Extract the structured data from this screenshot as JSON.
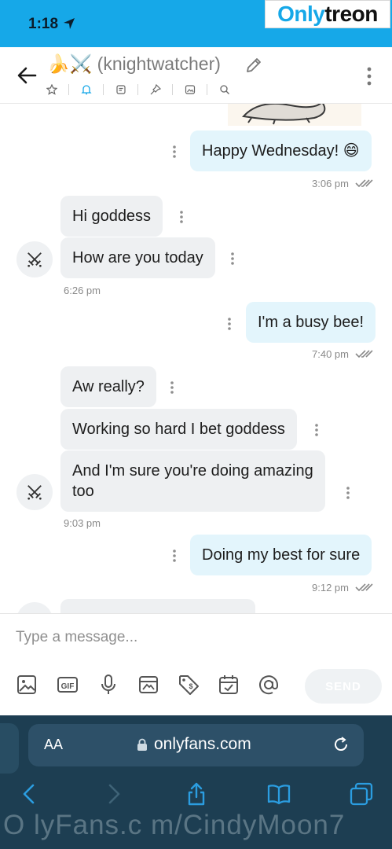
{
  "status_bar": {
    "time": "1:18"
  },
  "watermark": {
    "part1": "Only",
    "part2": "treon"
  },
  "header": {
    "contact_name": "🍌⚔️ (knightwatcher)"
  },
  "messages": [
    {
      "id": "m1",
      "direction": "outgoing",
      "text": "Happy Wednesday! 😄"
    },
    {
      "id": "m1-time",
      "text": "3:06 pm"
    },
    {
      "id": "m2",
      "direction": "incoming",
      "text": "Hi goddess"
    },
    {
      "id": "m3",
      "direction": "incoming",
      "text": "How are you today"
    },
    {
      "id": "m3-time",
      "text": "6:26 pm"
    },
    {
      "id": "m4",
      "direction": "outgoing",
      "text": "I'm a busy bee!"
    },
    {
      "id": "m4-time",
      "text": "7:40 pm"
    },
    {
      "id": "m5",
      "direction": "incoming",
      "text": "Aw really?"
    },
    {
      "id": "m6",
      "direction": "incoming",
      "text": "Working so hard I bet goddess"
    },
    {
      "id": "m7",
      "direction": "incoming",
      "line1": "And I'm sure you're doing amazing",
      "line2": "too"
    },
    {
      "id": "m7-time",
      "text": "9:03 pm"
    },
    {
      "id": "m8",
      "direction": "outgoing",
      "text": "Doing my best for sure"
    },
    {
      "id": "m8-time",
      "text": "9:12 pm"
    }
  ],
  "composer": {
    "placeholder": "Type a message...",
    "send_label": "SEND"
  },
  "browser": {
    "aa_label": "AA",
    "url": "onlyfans.com"
  },
  "bottom_watermark": "O lyFans.c m/CindyMoon7",
  "colors": {
    "accent": "#16a8e8",
    "outgoing_bubble": "#e3f5fc",
    "incoming_bubble": "#eef0f2",
    "browser_bar": "#1d3e52"
  },
  "icons": [
    "location-arrow-icon",
    "back-arrow-icon",
    "pencil-icon",
    "star-icon",
    "bell-icon",
    "note-icon",
    "pin-icon",
    "image-icon",
    "search-icon",
    "more-vertical-icon",
    "crossed-swords-icon",
    "double-check-icon",
    "gallery-icon",
    "gif-icon",
    "microphone-icon",
    "vault-icon",
    "price-tag-icon",
    "calendar-check-icon",
    "at-icon",
    "lock-icon",
    "reload-icon",
    "nav-back-icon",
    "nav-forward-icon",
    "share-icon",
    "bookmarks-icon",
    "tabs-icon"
  ]
}
